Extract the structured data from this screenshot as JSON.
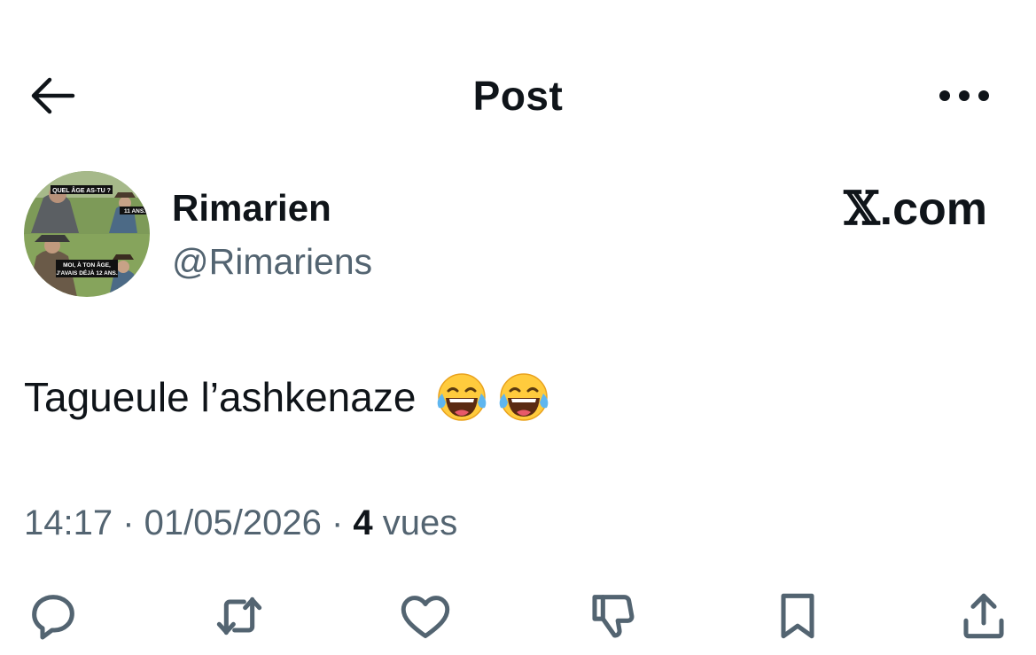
{
  "header": {
    "title": "Post"
  },
  "author": {
    "name": "Rimarien",
    "handle": "@Rimariens",
    "avatar_caption_top": "QUEL ÂGE AS-TU ?",
    "avatar_caption_mid": "11 ANS.",
    "avatar_caption_bottom_1": "MOI, À TON ÂGE,",
    "avatar_caption_bottom_2": "J'AVAIS DÉJÀ 12 ANS."
  },
  "watermark": {
    "x": "𝕏",
    "domain": ".com"
  },
  "post": {
    "text": "Tagueule l’ashkenaze",
    "emojis": [
      "face-with-tears-of-joy",
      "face-with-tears-of-joy"
    ]
  },
  "meta": {
    "time": "14:17",
    "sep1": " · ",
    "date": "01/05/2026",
    "sep2": " · ",
    "views_count": "4",
    "views_label": " vues"
  },
  "actions": {
    "icons": [
      "reply-icon",
      "repost-icon",
      "like-icon",
      "dislike-icon",
      "bookmark-icon",
      "share-icon"
    ]
  },
  "colors": {
    "text_primary": "#0f1419",
    "text_secondary": "#536471",
    "background": "#ffffff"
  }
}
